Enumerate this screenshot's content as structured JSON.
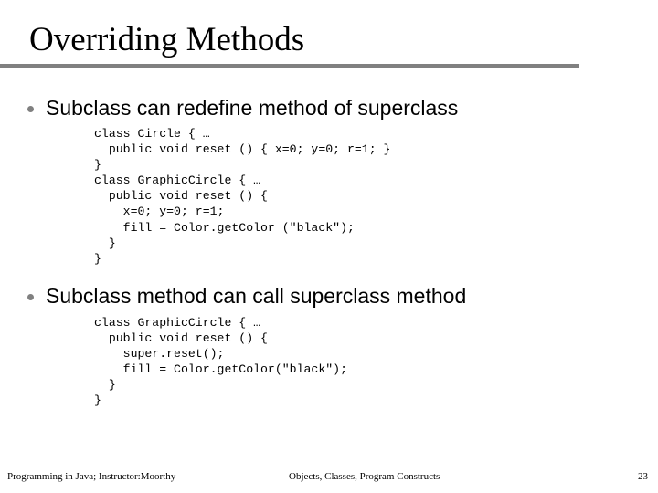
{
  "slide": {
    "title": "Overriding Methods",
    "rule_color": "#808080",
    "bullet_marker_color": "#808080",
    "bullets": [
      {
        "text": "Subclass can redefine method of superclass",
        "code": "class Circle { …\n  public void reset () { x=0; y=0; r=1; }\n}\nclass GraphicCircle { …\n  public void reset () {\n    x=0; y=0; r=1;\n    fill = Color.getColor (\"black\");\n  }\n}"
      },
      {
        "text": "Subclass method can call superclass method",
        "code": "class GraphicCircle { …\n  public void reset () {\n    super.reset();\n    fill = Color.getColor(\"black\");\n  }\n}"
      }
    ]
  },
  "footer": {
    "left": "Programming in Java; Instructor:Moorthy",
    "center": "Objects, Classes, Program Constructs",
    "page_number": "23"
  }
}
